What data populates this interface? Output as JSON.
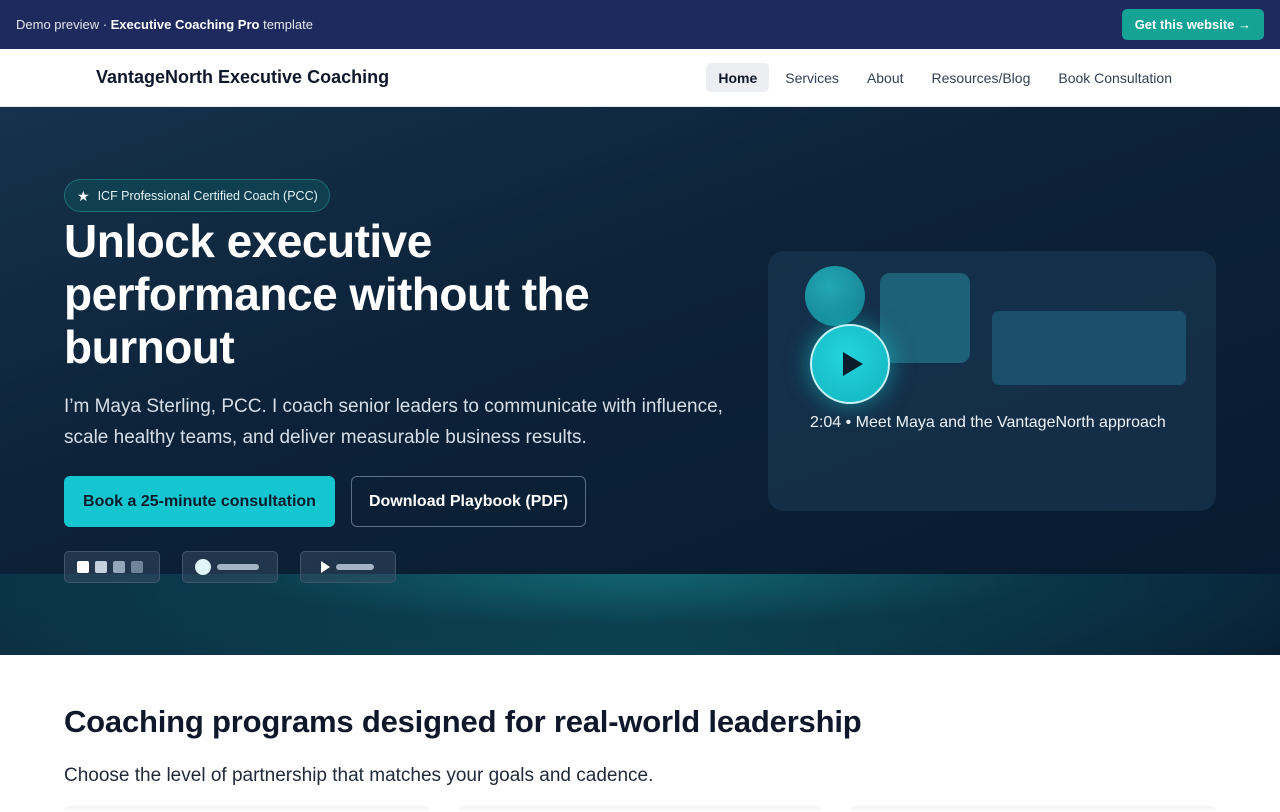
{
  "demo_bar": {
    "prefix": "Demo preview · ",
    "template_name": "Executive Coaching Pro",
    "suffix": " template",
    "cta_label": "Get this website →"
  },
  "header": {
    "brand": "VantageNorth Executive Coaching",
    "nav": [
      {
        "label": "Home",
        "active": true
      },
      {
        "label": "Services",
        "active": false
      },
      {
        "label": "About",
        "active": false
      },
      {
        "label": "Resources/Blog",
        "active": false
      },
      {
        "label": "Book Consultation",
        "active": false
      }
    ]
  },
  "hero": {
    "badge_icon": "star-icon",
    "badge_text": "ICF Professional Certified Coach (PCC)",
    "title": "Unlock executive performance without the burnout",
    "subtitle": "I’m Maya Sterling, PCC. I coach senior leaders to communicate with influence, scale healthy teams, and deliver measurable business results.",
    "primary_cta": "Book a 25-minute consultation",
    "secondary_cta": "Download Playbook (PDF)",
    "video_caption": "2:04 • Meet Maya and the VantageNorth approach"
  },
  "programs": {
    "title": "Coaching programs designed for real-world leadership",
    "subtitle": "Choose the level of partnership that matches your goals and cadence."
  },
  "colors": {
    "demo_bar_bg": "#1e2a5e",
    "demo_cta_bg": "#14a394",
    "hero_bg": "#0c2238",
    "accent": "#13c6cf"
  }
}
